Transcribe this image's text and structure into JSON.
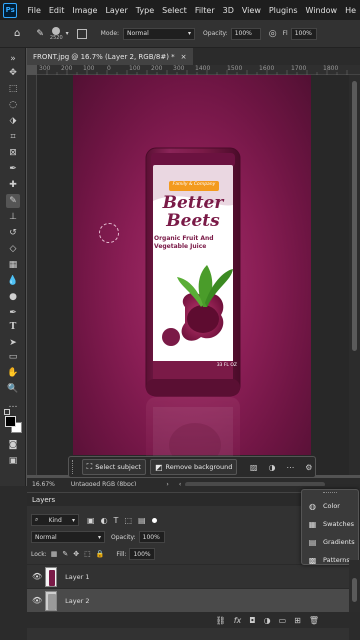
{
  "app": {
    "logo": "Ps"
  },
  "menu": [
    "File",
    "Edit",
    "Image",
    "Layer",
    "Type",
    "Select",
    "Filter",
    "3D",
    "View",
    "Plugins",
    "Window",
    "He"
  ],
  "options": {
    "brush_size": "2520",
    "mode_label": "Mode:",
    "mode_value": "Normal",
    "opacity_label": "Opacity:",
    "opacity_value": "100%",
    "flow_label": "Fl",
    "flow_value": "100%"
  },
  "document": {
    "tab_title": "FRONT.jpg @ 16.7% (Layer 2, RGB/8#) *",
    "close": "×"
  },
  "ruler": {
    "marks": [
      "300",
      "200",
      "100",
      "0",
      "100",
      "200",
      "300",
      "1400",
      "1500",
      "1600",
      "1700",
      "1800"
    ]
  },
  "product": {
    "brand_tag": "Family & Company",
    "title_line1": "Better",
    "title_line2": "Beets",
    "subtitle_line1": "Organic Fruit And",
    "subtitle_line2": "Vegetable Juice",
    "volume": "33 FL OZ"
  },
  "taskbar": {
    "select_subject": "Select subject",
    "remove_background": "Remove background"
  },
  "status": {
    "zoom": "16.67%",
    "profile": "Untagged RGB (8bpc)"
  },
  "layers_panel": {
    "title": "Layers",
    "filter_kind": "Kind",
    "blend_mode": "Normal",
    "opacity_label": "Opacity:",
    "opacity_value": "100%",
    "lock_label": "Lock:",
    "fill_label": "Fill:",
    "fill_value": "100%",
    "layers": [
      {
        "name": "Layer 1",
        "visible": true,
        "selected": false
      },
      {
        "name": "Layer 2",
        "visible": true,
        "selected": true
      }
    ]
  },
  "popup_panel": {
    "items": [
      {
        "label": "Color",
        "icon": "color-icon"
      },
      {
        "label": "Swatches",
        "icon": "swatches-icon"
      },
      {
        "label": "Gradients",
        "icon": "gradients-icon"
      },
      {
        "label": "Patterns",
        "icon": "patterns-icon"
      }
    ]
  },
  "colors": {
    "canvas_bg": "#8a1e55",
    "bottle": "#7a1a47",
    "label_bg": "#ffffff",
    "accent_orange": "#f39a1e",
    "accent_green": "#4a9c2a",
    "ps_blue": "#31a8ff"
  }
}
